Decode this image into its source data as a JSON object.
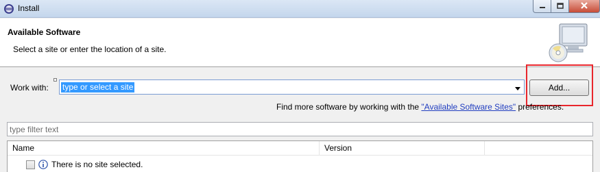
{
  "window": {
    "title": "Install",
    "icons": [
      "eclipse-icon",
      "minimize-icon",
      "maximize-icon",
      "close-icon"
    ]
  },
  "header": {
    "title": "Available Software",
    "description": "Select a site or enter the location of a site.",
    "graphic": "install-computer-cd-icon"
  },
  "work_with": {
    "label": "Work with:",
    "value": "type or select a site"
  },
  "add_button": {
    "label": "Add..."
  },
  "find_more": {
    "prefix": "Find more software by working with the ",
    "link": "\"Available Software Sites\"",
    "suffix": " preferences."
  },
  "filter": {
    "placeholder": "type filter text"
  },
  "table": {
    "columns": [
      "Name",
      "Version",
      ""
    ],
    "rows": [
      {
        "checked": false,
        "icon": "info-icon",
        "name": "There is no site selected."
      }
    ]
  },
  "colors": {
    "selection": "#3399ff",
    "link": "#1f3cbf",
    "highlight_box": "#e8262c"
  }
}
